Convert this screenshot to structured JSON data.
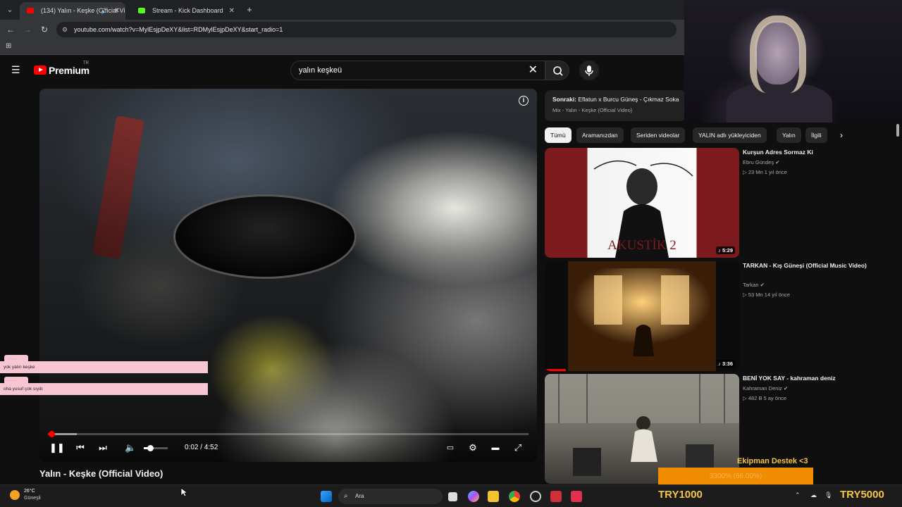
{
  "browser": {
    "tabs": [
      {
        "label": "(134) Yalın - Keşke (Official Vi",
        "active": true
      },
      {
        "label": "Stream - Kick Dashboard",
        "active": false
      }
    ],
    "url": "youtube.com/watch?v=MylEsjpDeXY&list=RDMylEsjpDeXY&start_radio=1"
  },
  "youtube": {
    "logo_text": "Premium",
    "logo_tr": "TR",
    "search_value": "yalın keşkeü"
  },
  "player": {
    "time": "0:02 / 4:52",
    "progress_fraction": 0.007,
    "buffered_fraction": 0.06,
    "volume_fraction": 0.25
  },
  "video_title": "Yalın - Keşke (Official Video)",
  "chat": [
    {
      "user": "........",
      "message": "yok yalın keşke"
    },
    {
      "user": "........",
      "message": "oha yusuf çok sıyıb"
    }
  ],
  "up_next": {
    "label": "Sonraki:",
    "title": "Eflatun x Burcu Güneş - Çıkmaz Soka",
    "subtitle": "Mix - Yalın - Keşke (Official Video)"
  },
  "chips": [
    "Tümü",
    "Aramanızdan",
    "Seriden videolar",
    "YALIN adlı yükleyiciden",
    "Yalın",
    "İlgili"
  ],
  "recommendations": [
    {
      "title": "Kurşun Adres Sormaz Ki",
      "channel": "Ebru Gündeş",
      "views": "▷ 23 Mn",
      "age": "1 yıl önce",
      "duration": "♪ 5:29",
      "thumb_text": "AKUSTİK 2"
    },
    {
      "title": "TARKAN - Kış Güneşi (Official Music Video)",
      "channel": "Tarkan",
      "views": "▷ 53 Mn",
      "age": "14 yıl önce",
      "duration": "♪ 3:36",
      "thumb_text": ""
    },
    {
      "title": "BENİ YOK SAY - kahraman deniz",
      "channel": "Kahraman Deniz",
      "views": "▷ 482 B",
      "age": "5 ay önce",
      "duration": "",
      "thumb_text": ""
    }
  ],
  "donation": {
    "title": "Ekipman Destek <3",
    "progress_text": "3300% (66.00%)",
    "left_amount": "TRY1000",
    "right_amount": "TRY5000"
  },
  "taskbar": {
    "temp": "26°C",
    "weather": "Güneşli",
    "search_label": "Ara"
  },
  "colors": {
    "yt_red": "#ff0000",
    "chat_bg": "#f8c6d2",
    "donation_orange": "#f08c00",
    "donation_text": "#f6c542"
  }
}
